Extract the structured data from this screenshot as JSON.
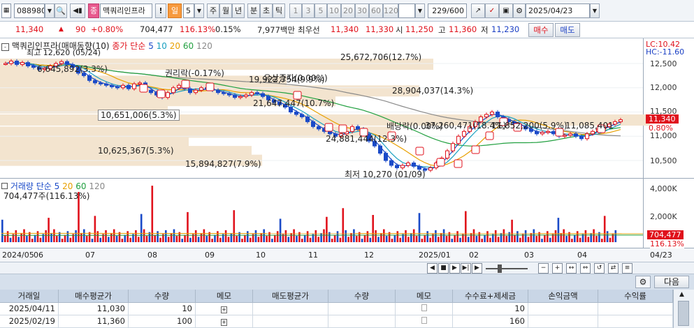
{
  "toolbar": {
    "code": "088980",
    "name": "맥쿼리인프라",
    "jong": "종",
    "exclaim": "!",
    "il": "일",
    "num": "5",
    "periods": [
      "주",
      "월",
      "년",
      "분",
      "초",
      "틱"
    ],
    "intervals": [
      "1",
      "3",
      "5",
      "10",
      "20",
      "30",
      "60",
      "120"
    ],
    "count": "229/600",
    "date": "2025/04/23"
  },
  "infobar": {
    "price": "11,340",
    "change": "90",
    "change_pct": "+0.80%",
    "volume": "704,477",
    "vol_ratio": "116.13%",
    "turnover": "0.15%",
    "amount": "7,977백만",
    "best_label": "최우선",
    "ask": "11,340",
    "bid": "11,330",
    "open_label": "시",
    "open": "11,250",
    "high_label": "고",
    "high": "11,360",
    "low_label": "저",
    "low": "11,230",
    "buy_button": "매수",
    "sell_button": "매도"
  },
  "price_chart": {
    "legend_name": "맥쿼리인프라(매매동향(10)",
    "legend_ma": "종가 단순",
    "ma_periods": [
      "5",
      "10",
      "20",
      "60",
      "120"
    ],
    "ma_colors": [
      "#1a4ac8",
      "#1aa0c0",
      "#e8a000",
      "#22a040",
      "#8a8a8a"
    ],
    "lc_label": "LC:10.42",
    "hc_label": "HC:-11.60",
    "y_ticks": [
      "12,500",
      "12,000",
      "11,500",
      "11,000",
      "10,500"
    ],
    "current_price": "11,340",
    "current_pct": "0.80%",
    "high_note": "최고 12,620 (05/24)",
    "low_note": "최저 10,270 (01/09)",
    "annotations": [
      "권리락(-0.17%)",
      "유상증자(0.00%)",
      "배당락(0.00%)"
    ],
    "volume_profile": [
      "25,672,706(12.7%)",
      "6,645,892(3.3%)",
      "19,922,754(9.9%)",
      "28,904,037(14.3%)",
      "21,647,447(10.7%)",
      "10,651,006(5.3%)",
      "37,260,471(18.4%)",
      "11,852,200(5.9%)",
      "11,085,401",
      "24,881,444(12.3%)",
      "10,625,367(5.3%)",
      "15,894,827(7.9%)"
    ]
  },
  "volume_chart": {
    "legend": "거래량 단순",
    "ma_periods": [
      "5",
      "20",
      "60",
      "120"
    ],
    "current_volume": "704,477주(116.13%)",
    "y_ticks": [
      "4,000K",
      "2,000K",
      "0"
    ],
    "current_value": "704,477",
    "current_pct": "116.13%"
  },
  "x_axis": [
    "2024/05",
    "06",
    "07",
    "08",
    "09",
    "10",
    "11",
    "12",
    "2025/01",
    "02",
    "03",
    "04",
    "04/23"
  ],
  "table": {
    "next_button": "다음",
    "headers": [
      "거래일",
      "매수평균가",
      "수량",
      "메모",
      "매도평균가",
      "수량",
      "메모",
      "수수료+제세금",
      "손익금액",
      "수익률"
    ],
    "rows": [
      [
        "2025/04/11",
        "11,030",
        "10",
        "",
        "",
        "",
        "",
        "10",
        "",
        ""
      ],
      [
        "2025/02/19",
        "11,360",
        "100",
        "",
        "",
        "",
        "",
        "160",
        "",
        ""
      ]
    ]
  },
  "chart_data": {
    "type": "candlestick",
    "x_range": [
      "2024/05",
      "2025/04/23"
    ],
    "y_range": [
      10270,
      12620
    ],
    "high": 12620,
    "low": 10270,
    "last": 11340
  }
}
